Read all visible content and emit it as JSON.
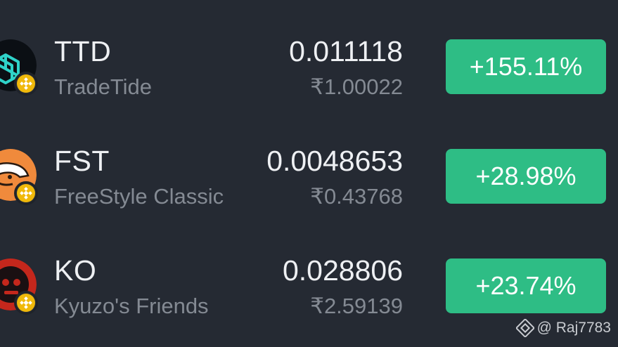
{
  "theme": {
    "background": "#252a33",
    "positive": "#2ebd85",
    "primary_text": "#eef0f3",
    "secondary_text": "#848a93",
    "chain_badge": "#f0b90b"
  },
  "tokens": [
    {
      "symbol": "TTD",
      "name": "TradeTide",
      "price": "0.011118",
      "fiat_price": "₹1.00022",
      "change": "+155.11%",
      "avatar_icon": "tradetide-logo-icon",
      "chain_icon": "bnb-chain-icon"
    },
    {
      "symbol": "FST",
      "name": "FreeStyle Classic",
      "price": "0.0048653",
      "fiat_price": "₹0.43768",
      "change": "+28.98%",
      "avatar_icon": "freestyle-logo-icon",
      "chain_icon": "bnb-chain-icon"
    },
    {
      "symbol": "KO",
      "name": "Kyuzo's Friends",
      "price": "0.028806",
      "fiat_price": "₹2.59139",
      "change": "+23.74%",
      "avatar_icon": "kyuzo-logo-icon",
      "chain_icon": "bnb-chain-icon"
    }
  ],
  "watermark": {
    "handle": "@ Raj7783",
    "icon": "binance-logo-icon"
  }
}
